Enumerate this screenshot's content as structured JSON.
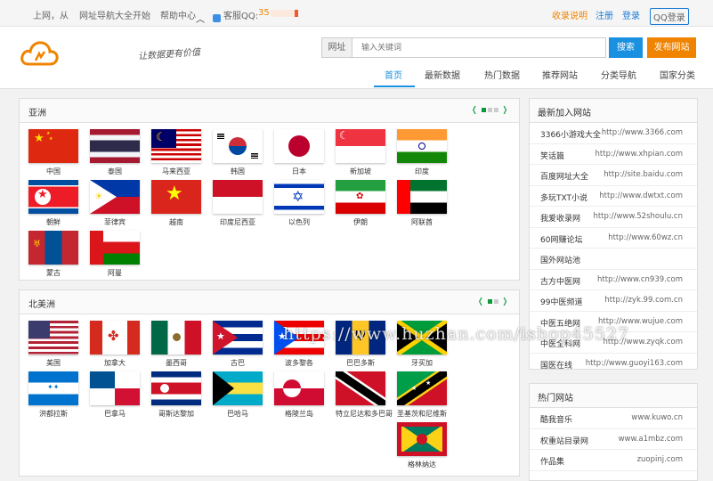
{
  "topbar": {
    "greeting": "上网，从",
    "start": "网址导航大全开始",
    "help": "帮助中心",
    "qq_label": "客服QQ:",
    "qq_number": "35",
    "include_info": "收录说明",
    "register": "注册",
    "login": "登录",
    "qq_login": "QQ登录"
  },
  "header": {
    "slogan": "让数据更有价值",
    "search_label": "网址",
    "search_placeholder": "输入关键词",
    "search_button": "搜索",
    "publish_button": "发布网站",
    "nav": [
      "首页",
      "最新数据",
      "热门数据",
      "推荐网站",
      "分类导航",
      "国家分类"
    ]
  },
  "asia": {
    "title": "亚洲",
    "pager_left": "❬",
    "pager_right": "❭",
    "countries": [
      "中国",
      "泰国",
      "马来西亚",
      "韩国",
      "日本",
      "新加坡",
      "印度",
      "朝鲜",
      "菲律宾",
      "越南",
      "印度尼西亚",
      "以色列",
      "伊朗",
      "阿联酋",
      "蒙古",
      "阿曼"
    ]
  },
  "north_america": {
    "title": "北美洲",
    "pager_left": "❬",
    "pager_right": "❭",
    "countries": [
      "美国",
      "加拿大",
      "墨西哥",
      "古巴",
      "波多黎各",
      "巴巴多斯",
      "牙买加",
      "洪都拉斯",
      "巴拿马",
      "哥斯达黎加",
      "巴哈马",
      "格陵兰岛",
      "特立尼达和多巴哥",
      "圣基茨和尼维斯",
      "格林纳达"
    ]
  },
  "latest": {
    "title": "最新加入网站",
    "items": [
      {
        "name": "3366小游戏大全",
        "url": "http://www.3366.com"
      },
      {
        "name": "笑话篇",
        "url": "http://www.xhpian.com"
      },
      {
        "name": "百度网址大全",
        "url": "http://site.baidu.com"
      },
      {
        "name": "多玩TXT小说",
        "url": "http://www.dwtxt.com"
      },
      {
        "name": "我爱收录网",
        "url": "http://www.52shoulu.cn"
      },
      {
        "name": "60网赚论坛",
        "url": "http://www.60wz.cn"
      },
      {
        "name": "国外网站池",
        "url": ""
      },
      {
        "name": "古方中医网",
        "url": "http://www.cn939.com"
      },
      {
        "name": "99中医频道",
        "url": "http://zyk.99.com.cn"
      },
      {
        "name": "中医五绝网",
        "url": "http://www.wujue.com"
      },
      {
        "name": "中医全科网",
        "url": "http://www.zyqk.com"
      },
      {
        "name": "国医在线",
        "url": "http://www.guoyi163.com"
      }
    ]
  },
  "hot": {
    "title": "热门网站",
    "items": [
      {
        "name": "酷我音乐",
        "url": "www.kuwo.cn"
      },
      {
        "name": "权重站目录网",
        "url": "www.a1mbz.com"
      },
      {
        "name": "作品集",
        "url": "zuopinj.com"
      }
    ]
  },
  "watermark": "https://www.huzhan.com/ishop45527",
  "colors": {
    "accent": "#1a90e0",
    "orange": "#f08300",
    "pager_green": "#0a9a3c"
  }
}
